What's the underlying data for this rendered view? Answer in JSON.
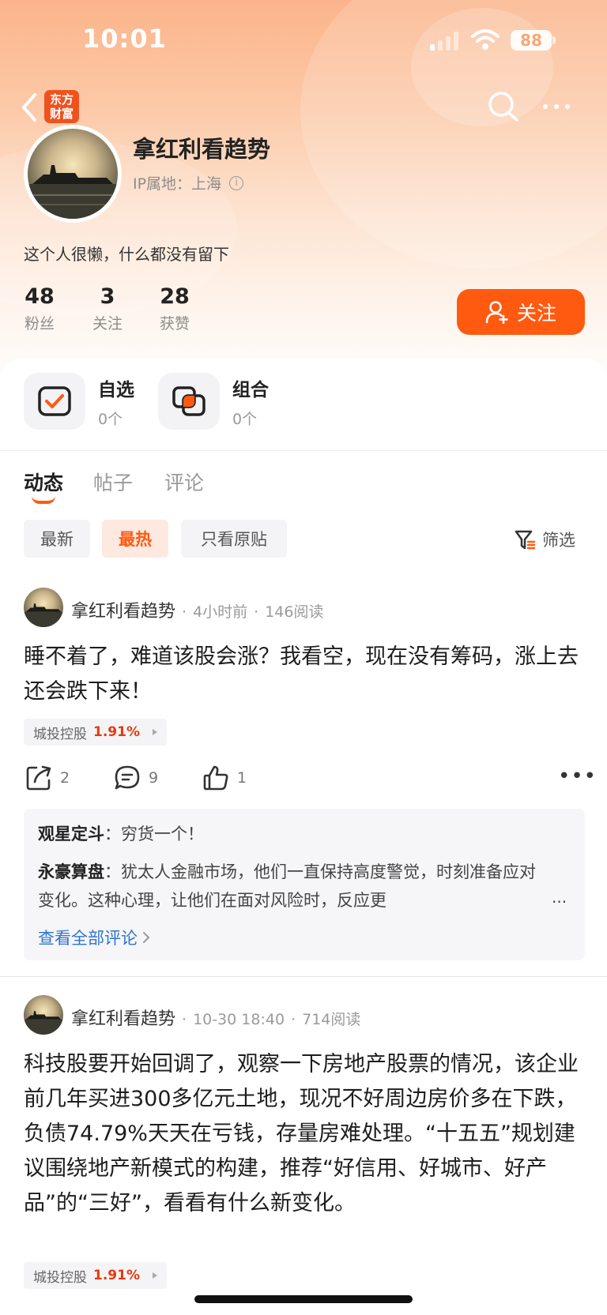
{
  "status_bar": {
    "time": "10:01",
    "battery": "88"
  },
  "nav": {
    "brand_line1": "东方",
    "brand_line2": "财富"
  },
  "profile": {
    "name": "拿红利看趋势",
    "ip_location": "IP属地：上海",
    "bio": "这个人很懒，什么都没有留下",
    "stats": [
      {
        "value": "48",
        "label": "粉丝"
      },
      {
        "value": "3",
        "label": "关注"
      },
      {
        "value": "28",
        "label": "获赞"
      }
    ],
    "follow_label": "关注"
  },
  "tiles": [
    {
      "title": "自选",
      "count": "0个"
    },
    {
      "title": "组合",
      "count": "0个"
    }
  ],
  "tabs": [
    "动态",
    "帖子",
    "评论"
  ],
  "filters": {
    "chips": [
      "最新",
      "最热",
      "只看原贴"
    ],
    "filter_label": "筛选"
  },
  "posts": [
    {
      "author": "拿红利看趋势",
      "time": "4小时前",
      "reads": "146阅读",
      "text": "睡不着了，难道该股会涨？我看空，现在没有筹码，涨上去还会跌下来！",
      "stock_name": "城投控股",
      "stock_pct": "1.91%",
      "shares": "2",
      "comments": "9",
      "likes": "1",
      "comment_preview": [
        {
          "user": "观星定斗",
          "text": "穷货一个！"
        },
        {
          "user": "永豪算盘",
          "text": "犹太人金融市场，他们一直保持高度警觉，时刻准备应对变化。这种心理，让他们在面对风险时，反应更"
        }
      ],
      "view_all": "查看全部评论"
    },
    {
      "author": "拿红利看趋势",
      "time": "10-30 18:40",
      "reads": "714阅读",
      "text": "科技股要开始回调了，观察一下房地产股票的情况，该企业前几年买进300多亿元土地，现况不好周边房价多在下跌，负债74.79%天天在亏钱，存量房难处理。“十五五”规划建议围绕地产新模式的构建，推荐“好信用、好城市、好产品”的“三好”，看看有什么新变化。",
      "stock_name": "城投控股",
      "stock_pct": "1.91%"
    }
  ],
  "colors": {
    "accent": "#ff5a10",
    "stock_up": "#e8380d",
    "link": "#2f74d0"
  }
}
